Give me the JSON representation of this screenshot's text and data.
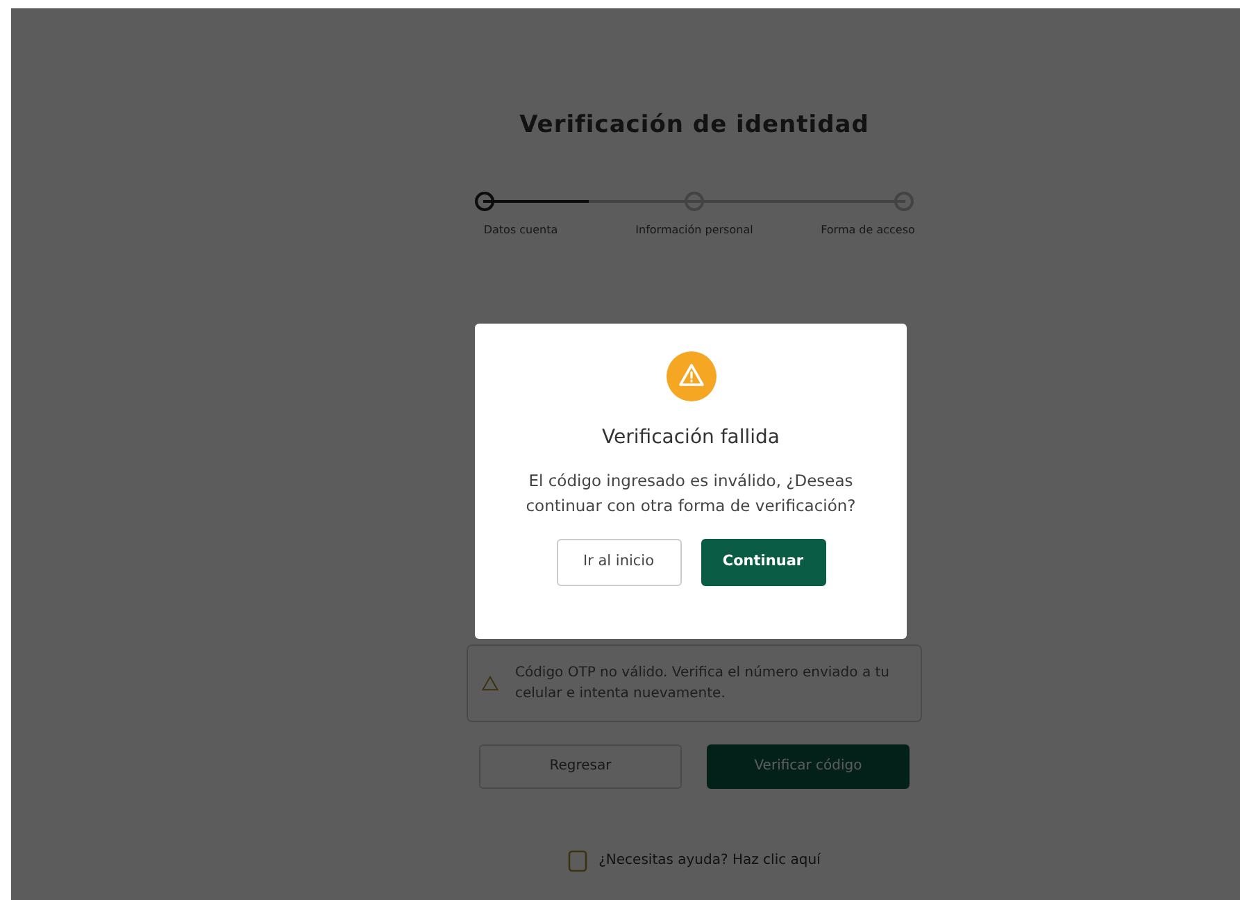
{
  "page": {
    "title": "Verificación de identidad",
    "stepper": {
      "level": 0.25,
      "steps": [
        {
          "label": "Datos cuenta",
          "selected": true
        },
        {
          "label": "Información personal",
          "selected": false
        },
        {
          "label": "Forma de acceso",
          "selected": false
        }
      ]
    },
    "alert": {
      "text": "Código OTP no válido. Verifica el número enviado a tu celular e intenta nuevamente."
    },
    "buttons": [
      {
        "label": "Regresar",
        "kind": "outline"
      },
      {
        "label": "Verificar código",
        "kind": "primary"
      }
    ],
    "help": {
      "text": "¿Necesitas ayuda? Haz clic aquí"
    }
  },
  "dialog": {
    "title": "Verificación fallida",
    "message": "El código ingresado es inválido, ¿Deseas continuar con otra forma de verificación?",
    "buttons": [
      {
        "label": "Ir al inicio",
        "kind": "outline"
      },
      {
        "label": "Continuar",
        "kind": "primary"
      }
    ]
  }
}
